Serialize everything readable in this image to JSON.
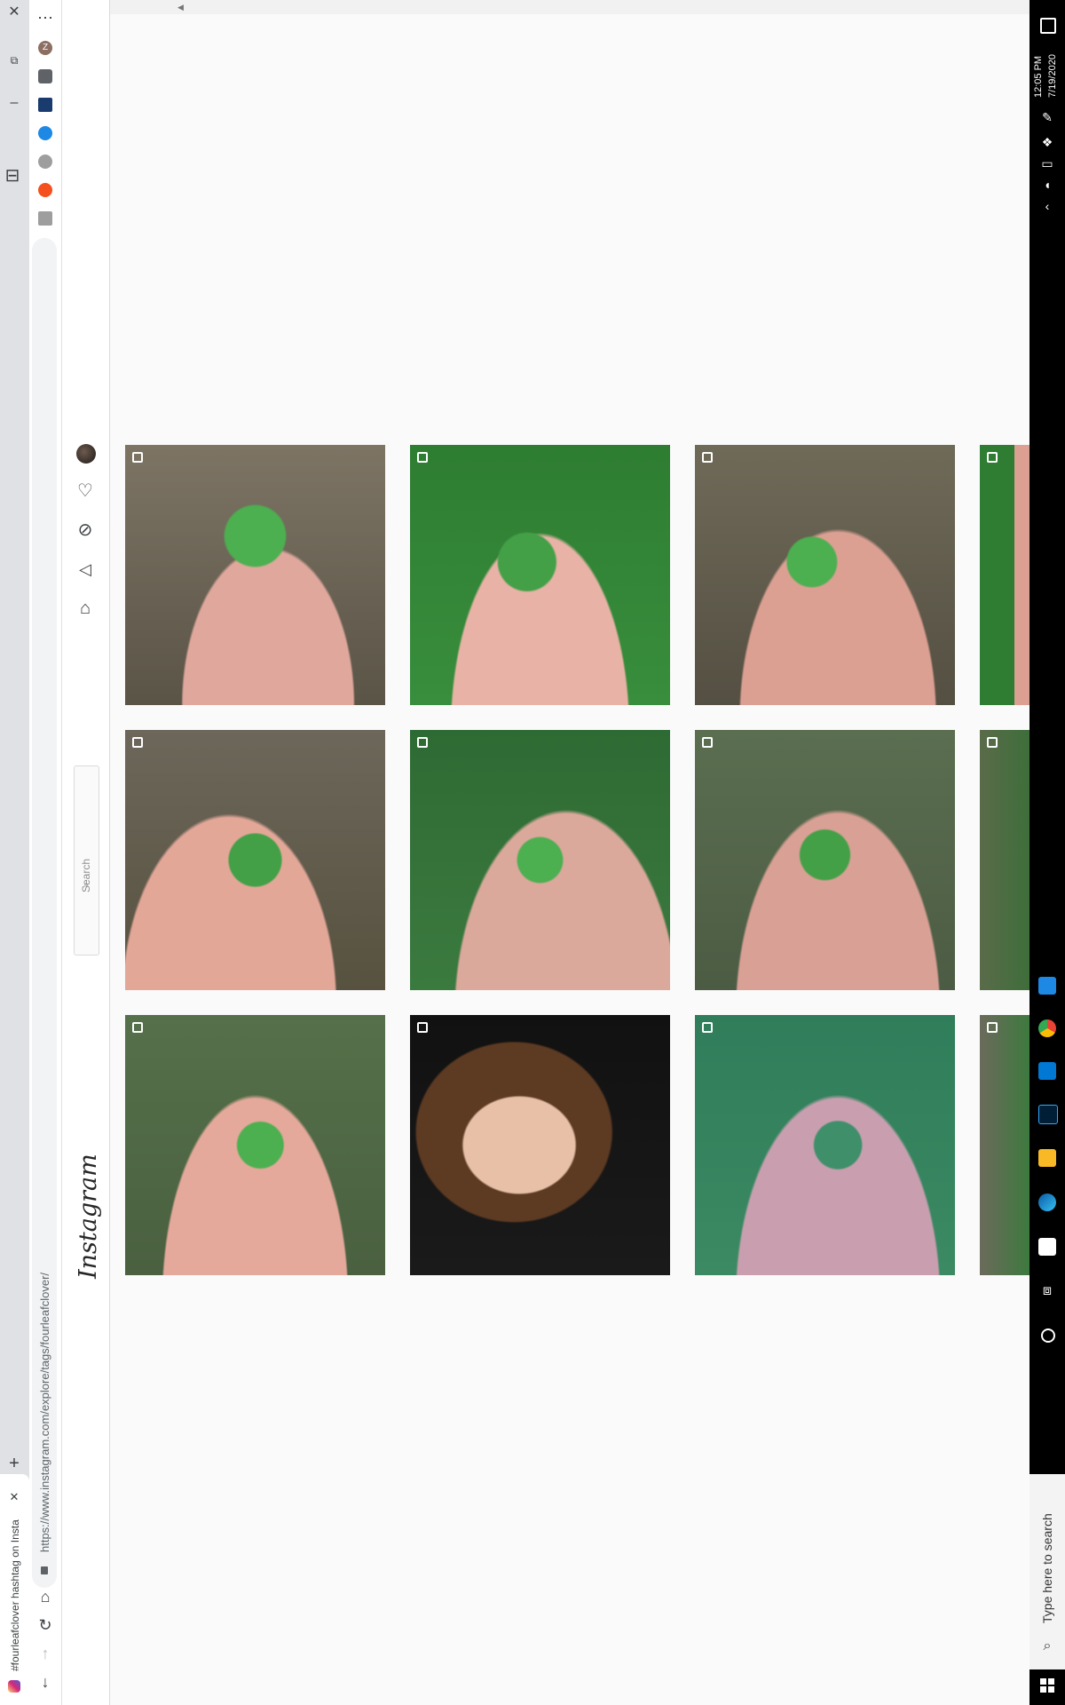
{
  "browser": {
    "tab_title": "#fourleafclover hashtag on Insta",
    "url": "https://www.instagram.com/explore/tags/fourleafclover/",
    "extension_avatar_letter": "Z"
  },
  "instagram": {
    "logo": "Instagram",
    "search_placeholder": "Search",
    "nav_icons": [
      "home-icon",
      "direct-icon",
      "explore-icon",
      "activity-heart-icon",
      "profile-avatar"
    ],
    "posts": [
      {
        "row": 1,
        "col": 1,
        "desc": "clover-on-fingers",
        "badge": "multiple-posts"
      },
      {
        "row": 1,
        "col": 2,
        "desc": "clover-on-fingers",
        "badge": "multiple-posts"
      },
      {
        "row": 1,
        "col": 3,
        "desc": "clover-on-fingers",
        "badge": "multiple-posts"
      },
      {
        "row": 1,
        "col": 4,
        "desc": "clover-partial",
        "badge": "multiple-posts"
      },
      {
        "row": 2,
        "col": 1,
        "desc": "clover-on-fingers",
        "badge": "multiple-posts"
      },
      {
        "row": 2,
        "col": 2,
        "desc": "clover-on-fingers",
        "badge": "multiple-posts"
      },
      {
        "row": 2,
        "col": 3,
        "desc": "clover-on-fingers",
        "badge": "multiple-posts"
      },
      {
        "row": 2,
        "col": 4,
        "desc": "clover-partial",
        "badge": "multiple-posts"
      },
      {
        "row": 3,
        "col": 1,
        "desc": "clover-on-fingers",
        "badge": "multiple-posts"
      },
      {
        "row": 3,
        "col": 2,
        "desc": "portrait-woman",
        "badge": "multiple-posts"
      },
      {
        "row": 3,
        "col": 3,
        "desc": "clover-on-fingers",
        "badge": "multiple-posts"
      },
      {
        "row": 3,
        "col": 4,
        "desc": "clover-partial",
        "badge": "multiple-posts"
      }
    ]
  },
  "taskbar": {
    "search_placeholder": "Type here to search",
    "time": "12:05 PM",
    "date": "7/19/2020"
  }
}
